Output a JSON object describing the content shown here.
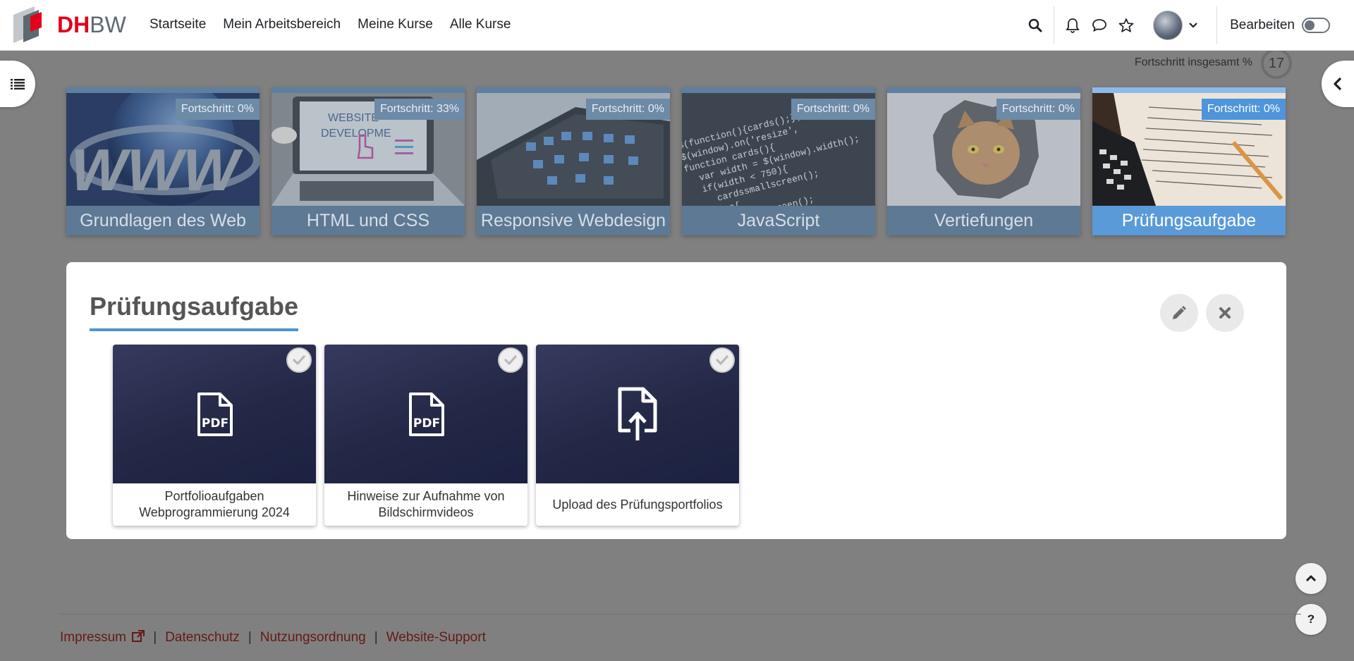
{
  "brand": {
    "logo_text_red": "DH",
    "logo_text_gray": "BW"
  },
  "nav": {
    "links": [
      "Startseite",
      "Mein Arbeitsbereich",
      "Meine Kurse",
      "Alle Kurse"
    ],
    "edit_label": "Bearbeiten"
  },
  "progress_total": {
    "label": "Fortschritt insgesamt %",
    "value": "17"
  },
  "tiles": [
    {
      "title": "Grundlagen des Web",
      "badge": "Fortschritt: 0%",
      "progress": 0
    },
    {
      "title": "HTML und CSS",
      "badge": "Fortschritt: 33%",
      "progress": 33
    },
    {
      "title": "Responsive Webdesign",
      "badge": "Fortschritt: 0%",
      "progress": 0
    },
    {
      "title": "JavaScript",
      "badge": "Fortschritt: 0%",
      "progress": 0
    },
    {
      "title": "Vertiefungen",
      "badge": "Fortschritt: 0%",
      "progress": 0
    },
    {
      "title": "Prüfungsaufgabe",
      "badge": "Fortschritt: 0%",
      "progress": 0,
      "active": true
    }
  ],
  "section": {
    "title": "Prüfungsaufgabe",
    "activities": [
      {
        "label": "Portfolioaufgaben Webprogrammierung 2024",
        "icon": "pdf-icon"
      },
      {
        "label": "Hinweise zur Aufnahme von Bildschirmvideos",
        "icon": "pdf-icon"
      },
      {
        "label": "Upload des Prüfungsportfolios",
        "icon": "file-upload-icon"
      }
    ]
  },
  "footer": {
    "links": [
      "Impressum",
      "Datenschutz",
      "Nutzungsordnung",
      "Website-Support"
    ],
    "separator": "|"
  },
  "colors": {
    "brand_red": "#e2001a",
    "accent_blue": "#4f93d6",
    "footer_link": "#631a16",
    "backdrop": "#808080"
  }
}
